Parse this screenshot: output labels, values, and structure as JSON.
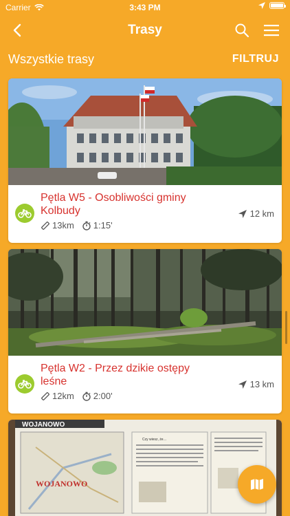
{
  "status_bar": {
    "carrier": "Carrier",
    "time": "3:43 PM"
  },
  "nav": {
    "title": "Trasy"
  },
  "subheader": {
    "all_routes": "Wszystkie trasy",
    "filter": "FILTRUJ"
  },
  "routes": [
    {
      "name": "Pętla W5 - Osobliwości gminy Kolbudy",
      "length": "13km",
      "duration": "1:15'",
      "distance": "12 km",
      "photo": "building-with-flags"
    },
    {
      "name": "Pętla W2 - Przez dzikie ostępy leśne",
      "length": "12km",
      "duration": "2:00'",
      "distance": "13 km",
      "photo": "forest"
    },
    {
      "photo": "map-board",
      "sign_text": "WOJANOWO",
      "sign_text_red": "WOJANOWO",
      "sign_caption": "Czy wiesz, że…"
    }
  ],
  "colors": {
    "primary": "#f6a928",
    "route_name": "#d7322e",
    "bike_badge": "#9ccb2f"
  }
}
